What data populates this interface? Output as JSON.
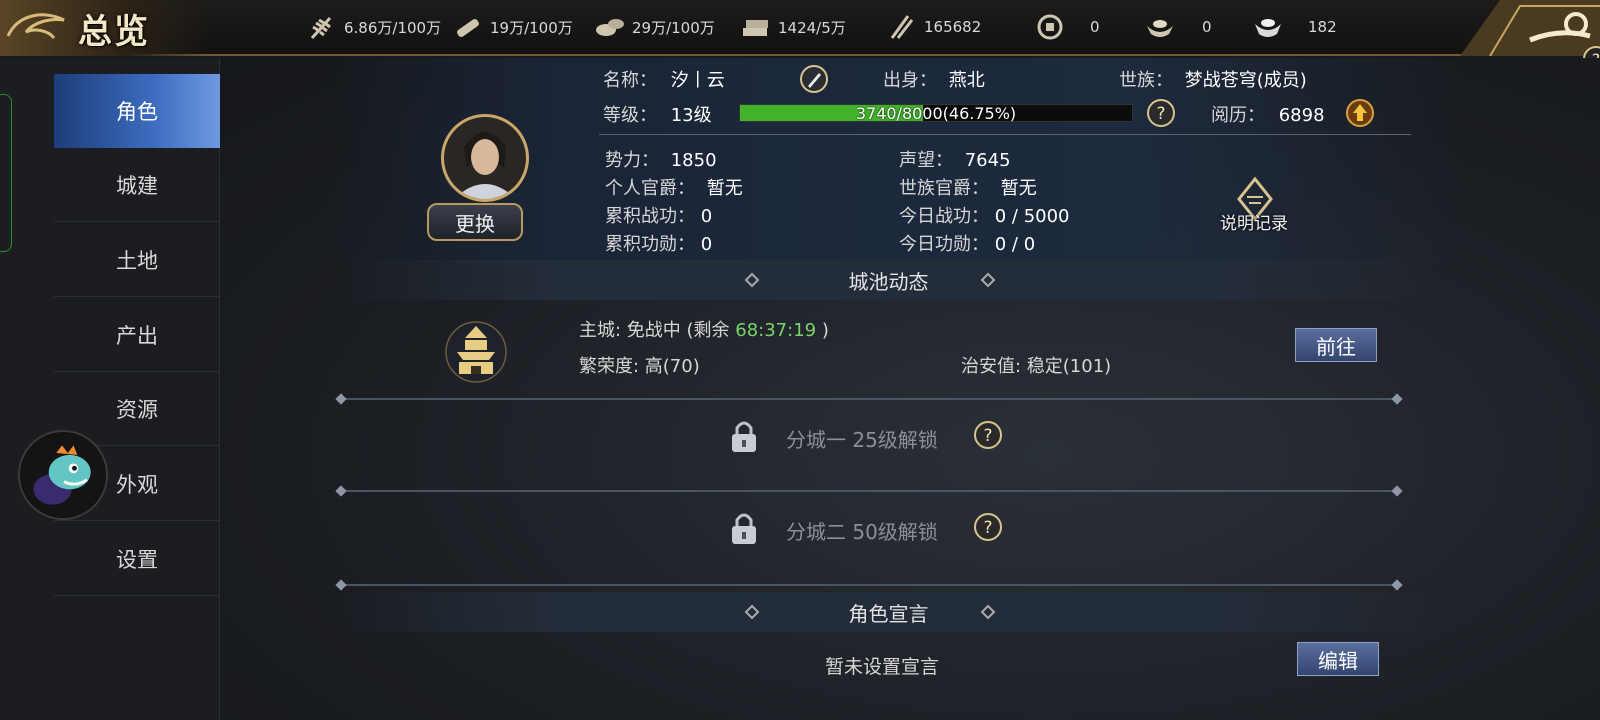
{
  "header": {
    "title": "总览",
    "resources": [
      {
        "icon": "grain-icon",
        "value": "6.86万/100万"
      },
      {
        "icon": "wood-icon",
        "value": "19万/100万"
      },
      {
        "icon": "stone-icon",
        "value": "29万/100万"
      },
      {
        "icon": "iron-icon",
        "value": "1424/5万"
      },
      {
        "icon": "troops-icon",
        "value": "165682"
      },
      {
        "icon": "coin-icon",
        "value": "0"
      },
      {
        "icon": "gold-ingot-icon",
        "value": "0"
      },
      {
        "icon": "silver-ingot-icon",
        "value": "182"
      }
    ]
  },
  "sidebar": {
    "items": [
      {
        "label": "角色",
        "active": true
      },
      {
        "label": "城建"
      },
      {
        "label": "土地"
      },
      {
        "label": "产出"
      },
      {
        "label": "资源"
      },
      {
        "label": "外观"
      },
      {
        "label": "设置"
      }
    ]
  },
  "profile": {
    "name_label": "名称：",
    "name_value": "汐丨云",
    "origin_label": "出身：",
    "origin_value": "燕北",
    "clan_label": "世族：",
    "clan_value": "梦战苍穹(成员)",
    "level_label": "等级：",
    "level_value": "13级",
    "xp_text": "3740/8000(46.75%)",
    "xp_fraction": 0.4675,
    "experience_label": "阅历：",
    "experience_value": "6898",
    "power_label": "势力：",
    "power_value": "1850",
    "reputation_label": "声望：",
    "reputation_value": "7645",
    "personal_rank_label": "个人官爵：",
    "personal_rank_value": "暂无",
    "clan_rank_label": "世族官爵：",
    "clan_rank_value": "暂无",
    "total_merit_label": "累积战功：",
    "total_merit_value": "0",
    "today_merit_label": "今日战功：",
    "today_merit_value": "0 / 5000",
    "total_honor_label": "累积功勋：",
    "total_honor_value": "0",
    "today_honor_label": "今日功勋：",
    "today_honor_value": "0 / 0",
    "swap_button": "更换",
    "record_button": "说明记录"
  },
  "city": {
    "section_title": "城池动态",
    "main_city_label": "主城: 免战中 (剩余 ",
    "timer": "68:37:19",
    "main_city_suffix": " )",
    "prosperity": "繁荣度: 高(70)",
    "security": "治安值: 稳定(101)",
    "goto_button": "前往",
    "branch1": "分城一 25级解锁",
    "branch2": "分城二 50级解锁"
  },
  "declaration": {
    "section_title": "角色宣言",
    "text": "暂未设置宣言",
    "edit_button": "编辑"
  },
  "colors": {
    "accent_gold": "#c8a868",
    "xp_green": "#41b42a",
    "nav_active": "#3d6cc0",
    "timer_green": "#7ad46b"
  }
}
